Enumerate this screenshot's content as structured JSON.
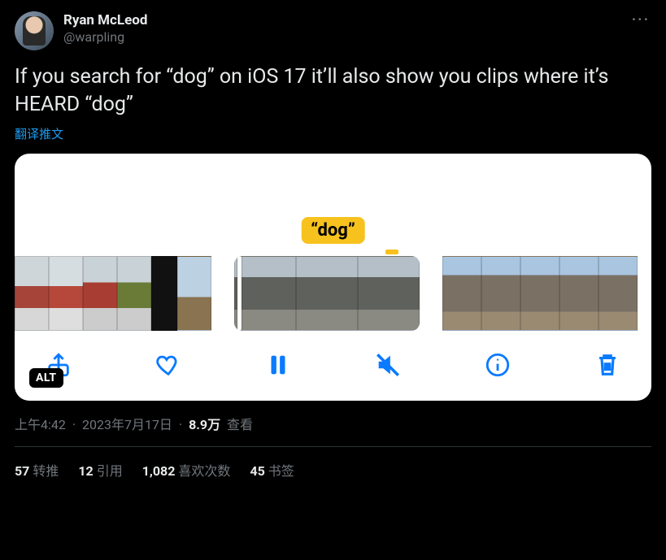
{
  "author": {
    "display_name": "Ryan McLeod",
    "handle": "@warpling"
  },
  "tweet_text": "If you search for “dog” on iOS 17 it’ll also show you clips where it’s HEARD “dog”",
  "translate_label": "翻译推文",
  "media": {
    "search_bubble": "“dog”",
    "alt_badge": "ALT"
  },
  "meta": {
    "time": "上午4:42",
    "date": "2023年7月17日",
    "views_number": "8.9万",
    "views_label": "查看"
  },
  "stats": {
    "retweets": {
      "count": "57",
      "label": "转推"
    },
    "quotes": {
      "count": "12",
      "label": "引用"
    },
    "likes": {
      "count": "1,082",
      "label": "喜欢次数"
    },
    "bookmarks": {
      "count": "45",
      "label": "书签"
    }
  }
}
